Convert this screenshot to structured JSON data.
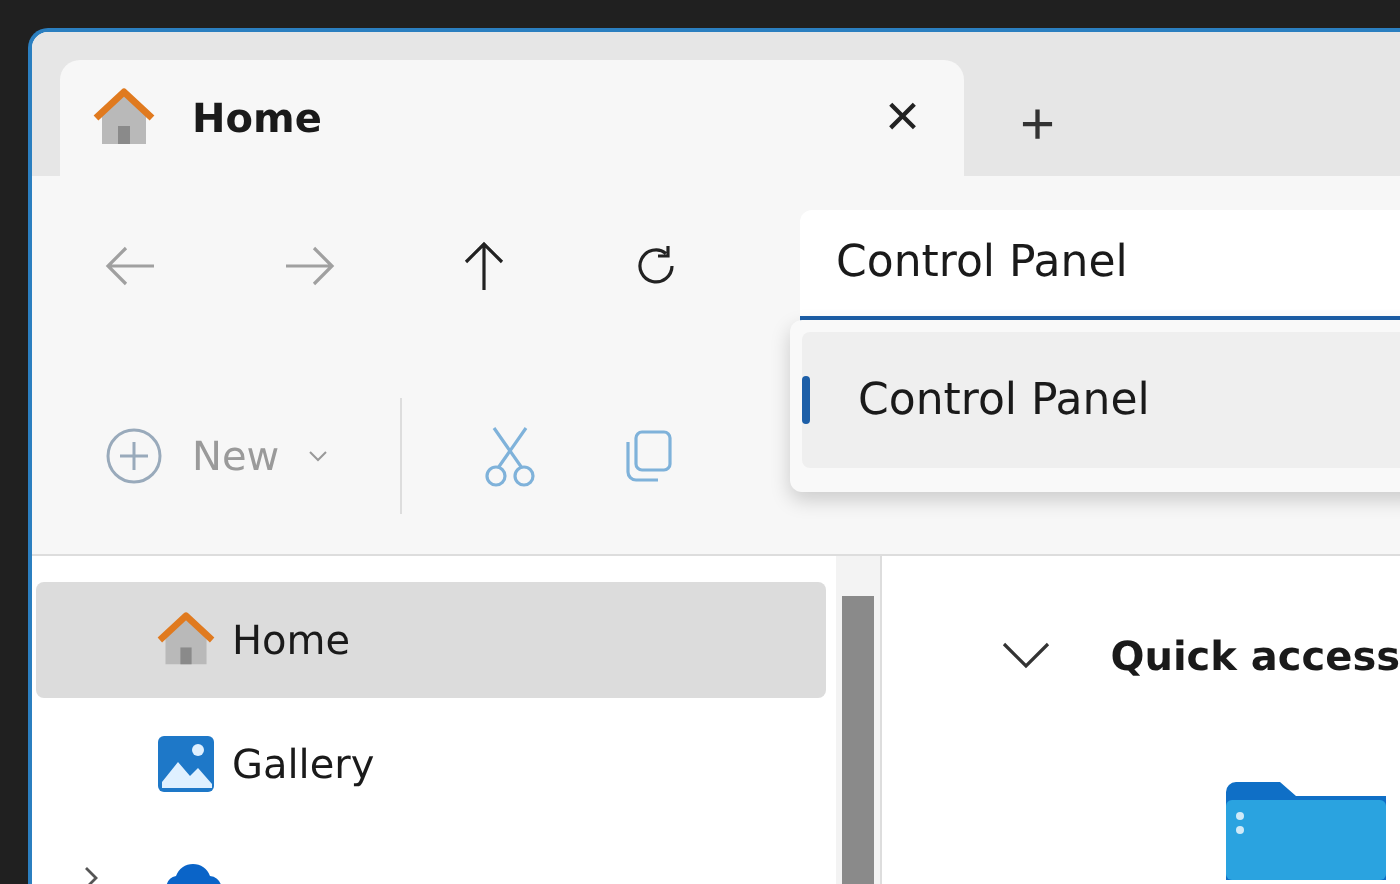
{
  "tabs": [
    {
      "label": "Home",
      "selected": true,
      "close": "×"
    }
  ],
  "new_tab": "+",
  "address": {
    "value": "Control Panel"
  },
  "suggestions": [
    {
      "label": "Control Panel",
      "selected": true
    }
  ],
  "commands": [
    {
      "kind": "new",
      "label": "New",
      "disabled": true
    },
    {
      "kind": "cut",
      "disabled": true
    },
    {
      "kind": "copy",
      "disabled": true
    }
  ],
  "sidebar": {
    "items": [
      {
        "label": "Home",
        "kind": "home",
        "selected": true
      },
      {
        "label": "Gallery",
        "kind": "gallery",
        "selected": false
      }
    ]
  },
  "content": {
    "section": "Quick access",
    "expanded": true
  }
}
